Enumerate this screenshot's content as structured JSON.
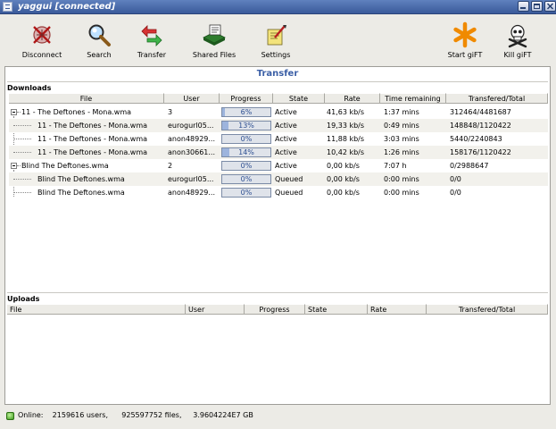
{
  "window": {
    "title": "yaggui [connected]"
  },
  "toolbar": {
    "disconnect": "Disconnect",
    "search": "Search",
    "transfer": "Transfer",
    "shared_files": "Shared Files",
    "settings": "Settings",
    "start_gift": "Start giFT",
    "kill_gift": "Kill giFT"
  },
  "panel": {
    "heading": "Transfer",
    "downloads_label": "Downloads",
    "uploads_label": "Uploads"
  },
  "downloads": {
    "columns": [
      "File",
      "User",
      "Progress",
      "State",
      "Rate",
      "Time remaining",
      "Transfered/Total"
    ],
    "rows": [
      {
        "file": "11 - The Deftones - Mona.wma",
        "user": "3",
        "progress": "6%",
        "progress_value": 6,
        "state": "Active",
        "rate": "41,63 kb/s",
        "time": "1:37 mins",
        "total": "312464/4481687",
        "level": 0,
        "expanded": true
      },
      {
        "file": "11 - The Deftones - Mona.wma",
        "user": "eurogurl05...",
        "progress": "13%",
        "progress_value": 13,
        "state": "Active",
        "rate": "19,33 kb/s",
        "time": "0:49 mins",
        "total": "148848/1120422",
        "level": 1
      },
      {
        "file": "11 - The Deftones - Mona.wma",
        "user": "anon48929...",
        "progress": "0%",
        "progress_value": 0,
        "state": "Active",
        "rate": "11,88 kb/s",
        "time": "3:03 mins",
        "total": "5440/2240843",
        "level": 1
      },
      {
        "file": "11 - The Deftones - Mona.wma",
        "user": "anon30661...",
        "progress": "14%",
        "progress_value": 14,
        "state": "Active",
        "rate": "10,42 kb/s",
        "time": "1:26 mins",
        "total": "158176/1120422",
        "level": 1
      },
      {
        "file": "Blind The Deftones.wma",
        "user": "2",
        "progress": "0%",
        "progress_value": 0,
        "state": "Active",
        "rate": "0,00 kb/s",
        "time": "7:07 h",
        "total": "0/2988647",
        "level": 0,
        "expanded": true
      },
      {
        "file": "Blind The Deftones.wma",
        "user": "eurogurl05...",
        "progress": "0%",
        "progress_value": 0,
        "state": "Queued",
        "rate": "0,00 kb/s",
        "time": "0:00 mins",
        "total": "0/0",
        "level": 1
      },
      {
        "file": "Blind The Deftones.wma",
        "user": "anon48929...",
        "progress": "0%",
        "progress_value": 0,
        "state": "Queued",
        "rate": "0,00 kb/s",
        "time": "0:00 mins",
        "total": "0/0",
        "level": 1
      }
    ]
  },
  "uploads": {
    "columns": [
      "File",
      "User",
      "Progress",
      "State",
      "Rate",
      "Transfered/Total"
    ]
  },
  "status": {
    "text": "Online:    2159616 users,      925597752 files,     3.9604224E7 GB"
  },
  "colors": {
    "title_bar": "#3a5a9a",
    "heading": "#3b5fa6",
    "progress_fill": "#9db4dd",
    "online_indicator": "#3e9a1d"
  }
}
